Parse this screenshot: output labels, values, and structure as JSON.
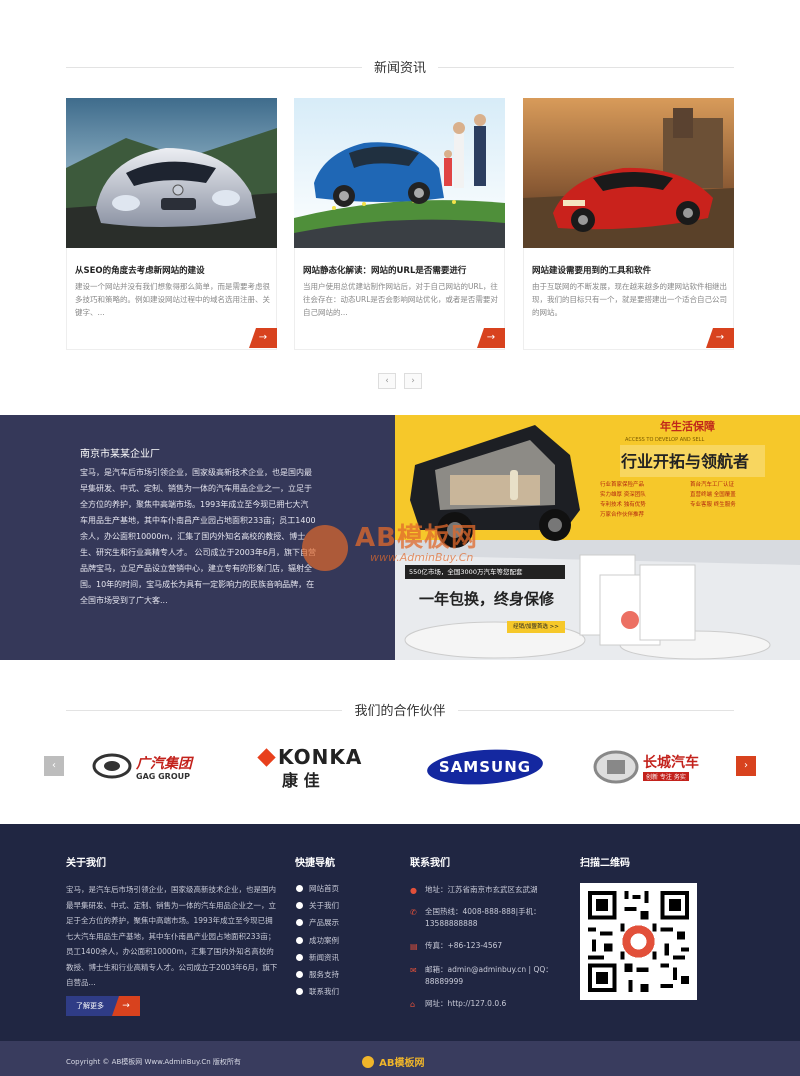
{
  "news": {
    "section_title": "新闻资讯",
    "cards": [
      {
        "title": "从SEO的角度去考虑新网站的建设",
        "desc": "建设一个网站并没有我们想象得那么简单，而是需要考虑很多技巧和策略的。例如建设网站过程中的域名选用注册、关键字、..."
      },
      {
        "title": "网站静态化解读：网站的URL是否需要进行",
        "desc": "当用户使用总优建站制作网站后，对于自己网站的URL，往往会存在：动态URL是否会影响网站优化，或者是否需要对自己网站的..."
      },
      {
        "title": "网站建设需要用到的工具和软件",
        "desc": "由于互联网的不断发展，现在越来越多的建网站软件相继出现，我们的目标只有一个，就是要搭建出一个适合自己公司的网站。"
      }
    ],
    "more_glyph": "→",
    "prev_glyph": "‹",
    "next_glyph": "›"
  },
  "about": {
    "company_name": "南京市某某企业厂",
    "text": "宝马，是汽车后市场引领企业，国家级高新技术企业，也是国内最早集研发、中式、定制、销售为一体的汽车用品企业之一，立足于全方位的养护，聚焦中高端市场。1993年成立至今现已拥七大汽车用品生产基地，其中车仆南昌产业园占地面积233亩；员工1400余人，办公面积10000m，汇集了国内外知名高校的教授、博士生、研究生和行业高精专人才。 公司成立于2003年6月，旗下自营品牌宝马，立足产品设立营销中心，建立专有的形象门店，辐射全国。10年的时间，宝马成长为具有一定影响力的民族音响品牌，在全国市场受到了广大客...",
    "banner": {
      "top_label": "年生活保障",
      "headline": "行业开拓与领航者",
      "sub_small": "ACCESS TO DEVELOP AND SELL",
      "bar_text": "550亿市场，全国3000万汽车等您配套",
      "slogan": "一年包换，终身保修",
      "cta": "经销/加盟首选 >>",
      "features": [
        "行业首家保险产品",
        "首台汽车工厂认证",
        "实力雄厚 资深团队",
        "直营终端 全国覆盖",
        "专利技术 独有优势",
        "专业客服 终生服务",
        "万家合作伙伴推荐"
      ]
    },
    "watermark_main": "AB模板网",
    "watermark_url": "www.AdminBuy.Cn"
  },
  "partners": {
    "section_title": "我们的合作伙伴",
    "logos": [
      {
        "name": "广汽集团",
        "sub": "GAG GROUP"
      },
      {
        "name": "KONKA",
        "sub": "康 佳"
      },
      {
        "name": "SAMSUNG",
        "sub": ""
      },
      {
        "name": "长城汽车",
        "sub": "创新 专注 务实"
      }
    ],
    "prev_glyph": "‹",
    "next_glyph": "›"
  },
  "footer": {
    "about_title": "关于我们",
    "about_text": "宝马，是汽车后市场引领企业，国家级高新技术企业，也是国内最早集研发、中式、定制、销售为一体的汽车用品企业之一，立足于全方位的养护，聚焦中高端市场。1993年成立至今现已拥七大汽车用品生产基地，其中车仆南昌产业园占地面积233亩；员工1400余人，办公面积10000m，汇集了国内外知名高校的教授、博士生和行业高精专人才。公司成立于2003年6月，旗下自营品...",
    "learn_more": "了解更多",
    "learn_more_arrow": "→",
    "nav_title": "快捷导航",
    "nav_items": [
      "网站首页",
      "关于我们",
      "产品展示",
      "成功案例",
      "新闻资讯",
      "服务支持",
      "联系我们"
    ],
    "contact_title": "联系我们",
    "contact": {
      "address": "地址：江苏省南京市玄武区玄武湖",
      "phone": "全国热线：4008-888-888|手机：13588888888",
      "fax": "传真：+86-123-4567",
      "email": "邮箱：admin@adminbuy.cn | QQ：88889999",
      "site": "网址：http://127.0.0.6"
    },
    "qr_title": "扫描二维码"
  },
  "copyright": "Copyright © AB模板网 Www.AdminBuy.Cn 版权所有",
  "bottom_logo": "AB模板网",
  "colors": {
    "accent": "#d8421e",
    "dark_navy": "#202642",
    "about_bg": "#353859",
    "banner_yellow": "#f6c82a"
  }
}
